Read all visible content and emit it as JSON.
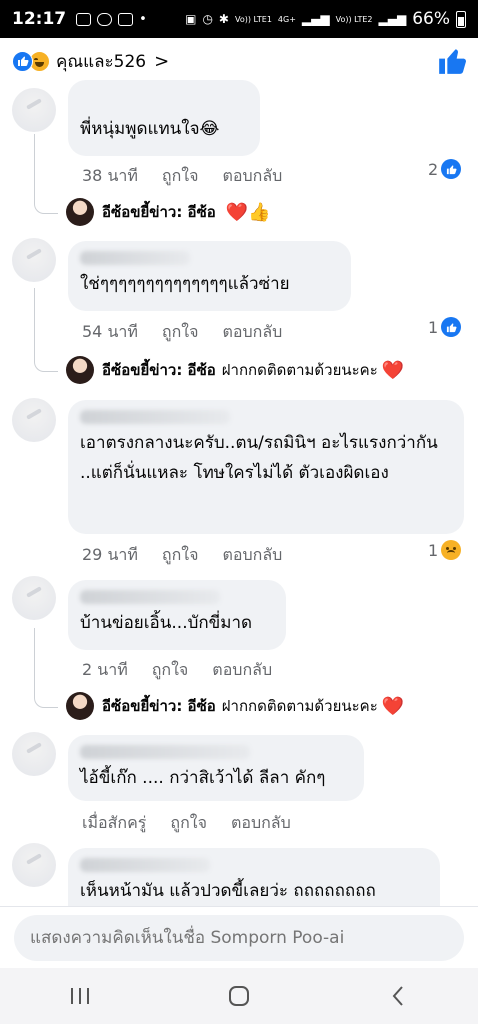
{
  "status_bar": {
    "time": "12:17",
    "dot": "•",
    "sim1_label": "Vo)) LTE1",
    "network": "4G+",
    "sim2_label": "Vo)) LTE2",
    "battery": "66%"
  },
  "reactions": {
    "summary": "คุณและ526",
    "chevron": ">"
  },
  "comments": [
    {
      "text": "พี่หนุ่มพูดแทนใจ😂",
      "time": "38 นาที",
      "like": "ถูกใจ",
      "reply": "ตอบกลับ",
      "count": "2",
      "reaction": "like-icon"
    },
    {
      "text": "ใช่ๆๆๆๆๆๆๆๆๆๆๆๆๆๆแล้วซ่าย",
      "time": "54 นาที",
      "like": "ถูกใจ",
      "reply": "ตอบกลับ",
      "count": "1",
      "reaction": "like-icon"
    },
    {
      "text": "เอาตรงกลางนะครับ..ตน/รถมินิฯ อะไรแรงกว่ากัน ..แต่ก็นั่นแหละ โทษใครไม่ได้ ตัวเองผิดเอง",
      "time": "29 นาที",
      "like": "ถูกใจ",
      "reply": "ตอบกลับ",
      "count": "1",
      "reaction": "sad-icon"
    },
    {
      "text": "บ้านข่อยเอิ้น...บักขี่มาด",
      "time": "2 นาที",
      "like": "ถูกใจ",
      "reply": "ตอบกลับ"
    },
    {
      "text": "ไอ้ขี้เก๊ก .... กว่าสิเว้าได้ ลีลา คักๆ",
      "time": "เมื่อสักครู่",
      "like": "ถูกใจ",
      "reply": "ตอบกลับ"
    },
    {
      "text": "เห็นหน้ามัน แล้วปวดขี้เลยว่ะ ถถถถถถถถ"
    }
  ],
  "replies": [
    {
      "name": "อีซ้อขยี้ข่าว: อีซ้อ",
      "text": "",
      "emoji": "❤️👍"
    },
    {
      "name": "อีซ้อขยี้ข่าว: อีซ้อ",
      "text": "ฝากกดติดตามด้วยนะคะ",
      "emoji": "❤️"
    },
    {
      "name": "อีซ้อขยี้ข่าว: อีซ้อ",
      "text": "ฝากกดติดตามด้วยนะคะ",
      "emoji": "❤️"
    }
  ],
  "composer": {
    "placeholder": "แสดงความคิดเห็นในชื่อ Somporn Poo-ai"
  },
  "colors": {
    "accent": "#1877f2",
    "bubble": "#f0f2f5",
    "meta_text": "#65676b",
    "heart": "#e41e3f"
  }
}
